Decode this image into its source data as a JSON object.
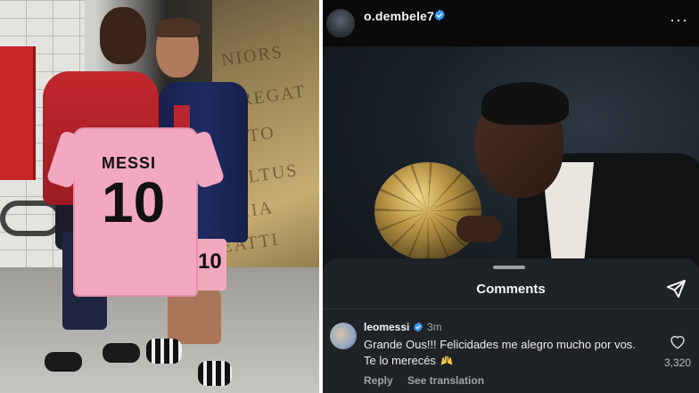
{
  "left_photo": {
    "shirt_name": "MESSI",
    "shirt_number": "10",
    "shorts_number": "10",
    "wall_text": [
      "NIORS",
      "E REGAT",
      "ORTO",
      "VELTUS",
      "EMIA",
      "EATTI"
    ]
  },
  "instagram": {
    "header": {
      "username": "o.dembele7",
      "more_icon": "more-icon",
      "more_label": "···"
    },
    "comments_sheet": {
      "title": "Comments",
      "share_icon": "send-icon",
      "comment": {
        "username": "leomessi",
        "time": "3m",
        "text": "Grande Ous!!! Felicidades me alegro mucho por vos. Te lo merecés",
        "emoji": "raised-hands",
        "likes": "3,320",
        "reply_label": "Reply",
        "translate_label": "See translation"
      }
    },
    "colors": {
      "background": "#0c0c0c",
      "sheet": "#1f2226",
      "verified": "#3897f0",
      "text_primary": "#f5f5f5",
      "text_secondary": "#a0a4a8"
    }
  }
}
